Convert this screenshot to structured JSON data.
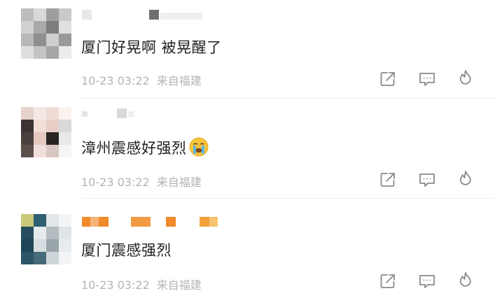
{
  "comments": [
    {
      "text": "厦门好晃啊 被晃醒了",
      "time": "10-23 03:22",
      "location": "来自福建",
      "has_emoji": false
    },
    {
      "text": "漳州震感好强烈",
      "time": "10-23 03:22",
      "location": "来自福建",
      "has_emoji": true,
      "emoji": "crying-face"
    },
    {
      "text": "厦门震感强烈",
      "time": "10-23 03:22",
      "location": "来自福建",
      "has_emoji": false
    }
  ],
  "actions": [
    "share-icon",
    "comment-icon",
    "like-flame-icon"
  ],
  "colors": {
    "text": "#1f1f1f",
    "meta": "#b4b4b4",
    "icon": "#8a8a8a",
    "name_bar": "#f08a2a"
  }
}
